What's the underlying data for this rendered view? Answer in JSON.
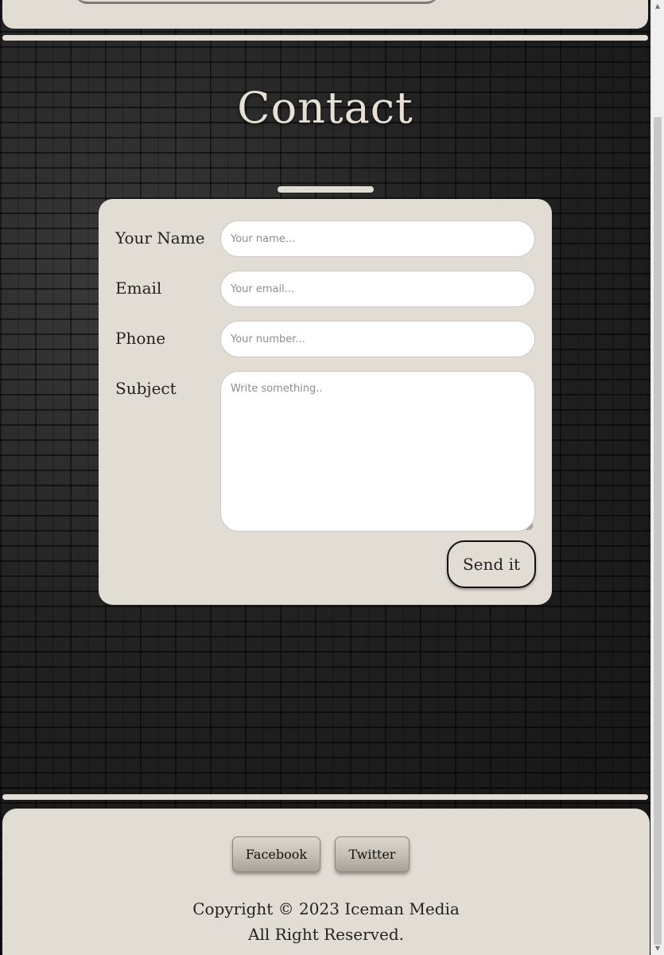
{
  "page": {
    "title": "Contact"
  },
  "form": {
    "fields": [
      {
        "label": "Your Name",
        "placeholder": "Your name..."
      },
      {
        "label": "Email",
        "placeholder": "Your email..."
      },
      {
        "label": "Phone",
        "placeholder": "Your number..."
      },
      {
        "label": "Subject",
        "placeholder": "Write something.."
      }
    ],
    "submit_label": "Send it"
  },
  "footer": {
    "social": [
      {
        "label": "Facebook"
      },
      {
        "label": "Twitter"
      }
    ],
    "copyright_line1": "Copyright © 2023 Iceman Media",
    "copyright_line2": "All Right Reserved."
  },
  "scrollbar": {
    "up_icon": "triangle-up",
    "down_icon": "triangle-down"
  },
  "colors": {
    "panel": "#e2ddd4",
    "background": "#1d1d1d",
    "text": "#222222"
  }
}
